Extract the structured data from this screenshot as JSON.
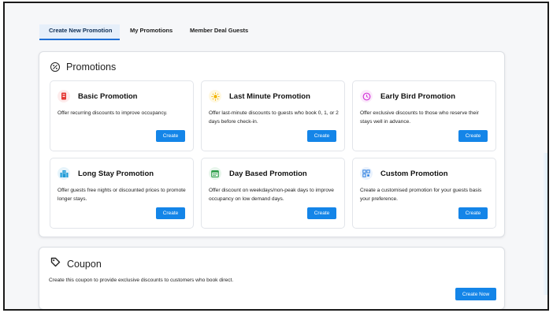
{
  "tabs": [
    {
      "label": "Create New Promotion",
      "active": true
    },
    {
      "label": "My Promotions",
      "active": false
    },
    {
      "label": "Member Deal Guests",
      "active": false
    }
  ],
  "promotions_section": {
    "title": "Promotions",
    "icon": "percent-badge-icon"
  },
  "promotions": [
    {
      "name": "Basic Promotion",
      "description": "Offer recurring discounts to improve occupancy.",
      "button": "Create",
      "icon": "tag-icon",
      "icon_color": "#e53935",
      "icon_bg": "#fdecec"
    },
    {
      "name": "Last Minute Promotion",
      "description": "Offer last-minute discounts to guests who book 0, 1, or 2 days before check-in.",
      "button": "Create",
      "icon": "sun-icon",
      "icon_color": "#f2b400",
      "icon_bg": "#fff8e0"
    },
    {
      "name": "Early Bird Promotion",
      "description": "Offer exclusive discounts to those who reserve their stays well in advance.",
      "button": "Create",
      "icon": "clock-icon",
      "icon_color": "#d43ad9",
      "icon_bg": "#fbe9fb"
    },
    {
      "name": "Long Stay Promotion",
      "description": "Offer guests free nights or discounted prices to promote longer stays.",
      "button": "Create",
      "icon": "building-icon",
      "icon_color": "#1e9bd7",
      "icon_bg": "#e6f4fb"
    },
    {
      "name": "Day Based Promotion",
      "description": "Offer discount on weekdays/non-peak days to improve occupancy on low demand days.",
      "button": "Create",
      "icon": "calendar-icon",
      "icon_color": "#2e9e4a",
      "icon_bg": "#e8f6ec"
    },
    {
      "name": "Custom Promotion",
      "description": "Create a customised promotion for your guests basis your preference.",
      "button": "Create",
      "icon": "grid-icon",
      "icon_color": "#2d7fe0",
      "icon_bg": "#eaf2fd"
    }
  ],
  "coupon": {
    "title": "Coupon",
    "description": "Create this coupon to provide exclusive discounts to customers who book direct.",
    "button": "Create Now",
    "icon": "coupon-tag-icon"
  },
  "colors": {
    "accent": "#1485e8",
    "active_tab_bg": "#e6effa",
    "active_tab_border": "#1f6fd6"
  }
}
